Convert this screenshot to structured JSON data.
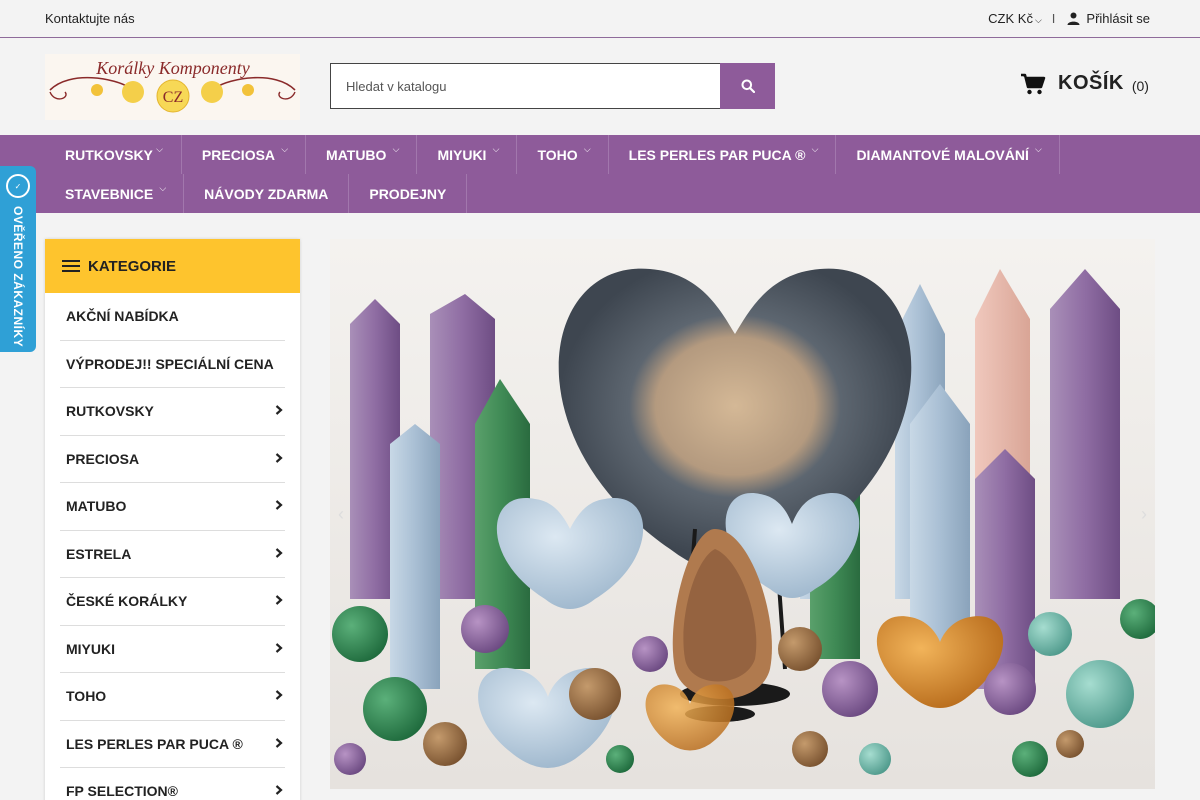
{
  "topbar": {
    "contact": "Kontaktujte nás",
    "currency": "CZK Kč",
    "separator": "I",
    "login": "Přihlásit se"
  },
  "logo": {
    "title": "Korálky Komponenty",
    "badge": "CZ"
  },
  "search": {
    "placeholder": "Hledat v katalogu"
  },
  "cart": {
    "label": "KOŠÍK",
    "count": "(0)"
  },
  "nav": {
    "row1": [
      "RUTKOVSKY",
      "PRECIOSA",
      "MATUBO",
      "MIYUKI",
      "TOHO",
      "LES PERLES PAR PUCA ®",
      "DIAMANTOVÉ MALOVÁNÍ"
    ],
    "row2": [
      "STAVEBNICE",
      "NÁVODY ZDARMA",
      "PRODEJNY"
    ]
  },
  "verified": {
    "text": "OVĚŘENO ZÁKAZNÍKY",
    "icon": "heureka-badge-icon"
  },
  "categories": {
    "title": "KATEGORIE",
    "items": [
      {
        "label": "AKČNÍ NABÍDKA",
        "has_sub": false
      },
      {
        "label": "VÝPRODEJ!! SPECIÁLNÍ CENA",
        "has_sub": false
      },
      {
        "label": "RUTKOVSKY",
        "has_sub": true
      },
      {
        "label": "PRECIOSA",
        "has_sub": true
      },
      {
        "label": "MATUBO",
        "has_sub": true
      },
      {
        "label": "ESTRELA",
        "has_sub": true
      },
      {
        "label": "ČESKÉ KORÁLKY",
        "has_sub": true
      },
      {
        "label": "MIYUKI",
        "has_sub": true
      },
      {
        "label": "TOHO",
        "has_sub": true
      },
      {
        "label": "LES PERLES PAR PUCA ®",
        "has_sub": true
      },
      {
        "label": "FP SELECTION®",
        "has_sub": true
      }
    ]
  },
  "colors": {
    "accent": "#8e5b9a",
    "category_header": "#fec42d",
    "badge": "#2fa0d6"
  }
}
